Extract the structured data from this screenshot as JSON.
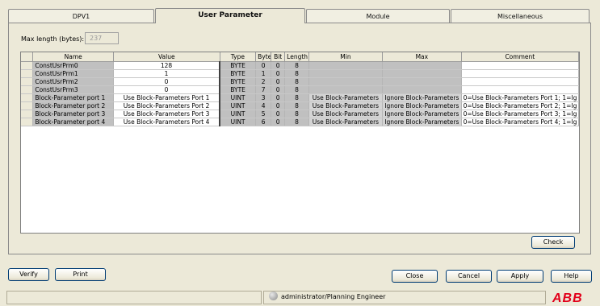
{
  "tabs": [
    "DPV1",
    "User Parameter",
    "Module",
    "Miscellaneous"
  ],
  "max_length": {
    "label": "Max length (bytes):",
    "value": "237"
  },
  "columns": [
    "Name",
    "Value",
    "Type",
    "Byte",
    "Bit",
    "Length",
    "Min",
    "Max",
    "Comment"
  ],
  "rows": [
    {
      "name": "ConstUsrPrm0",
      "value": "128",
      "type": "BYTE",
      "byte": "0",
      "bit": "0",
      "length": "8",
      "min": "",
      "max": "",
      "comment": ""
    },
    {
      "name": "ConstUsrPrm1",
      "value": "1",
      "type": "BYTE",
      "byte": "1",
      "bit": "0",
      "length": "8",
      "min": "",
      "max": "",
      "comment": ""
    },
    {
      "name": "ConstUsrPrm2",
      "value": "0",
      "type": "BYTE",
      "byte": "2",
      "bit": "0",
      "length": "8",
      "min": "",
      "max": "",
      "comment": ""
    },
    {
      "name": "ConstUsrPrm3",
      "value": "0",
      "type": "BYTE",
      "byte": "7",
      "bit": "0",
      "length": "8",
      "min": "",
      "max": "",
      "comment": ""
    },
    {
      "name": "Block-Parameter port 1",
      "value": "Use Block-Parameters Port 1",
      "type": "UINT",
      "byte": "3",
      "bit": "0",
      "length": "8",
      "min": "Use Block-Parameters",
      "max": "Ignore Block-Parameters",
      "comment": "0=Use Block-Parameters Port 1; 1=Ig"
    },
    {
      "name": "Block-Parameter port 2",
      "value": "Use Block-Parameters Port 2",
      "type": "UINT",
      "byte": "4",
      "bit": "0",
      "length": "8",
      "min": "Use Block-Parameters",
      "max": "Ignore Block-Parameters",
      "comment": "0=Use Block-Parameters Port 2; 1=Ig"
    },
    {
      "name": "Block-Parameter port 3",
      "value": "Use Block-Parameters Port 3",
      "type": "UINT",
      "byte": "5",
      "bit": "0",
      "length": "8",
      "min": "Use Block-Parameters",
      "max": "Ignore Block-Parameters",
      "comment": "0=Use Block-Parameters Port 3; 1=Ig"
    },
    {
      "name": "Block-Parameter port 4",
      "value": "Use Block-Parameters Port 4",
      "type": "UINT",
      "byte": "6",
      "bit": "0",
      "length": "8",
      "min": "Use Block-Parameters",
      "max": "Ignore Block-Parameters",
      "comment": "0=Use Block-Parameters Port 4; 1=Ig"
    }
  ],
  "buttons": {
    "check": "Check",
    "verify": "Verify",
    "print": "Print",
    "close": "Close",
    "cancel": "Cancel",
    "apply": "Apply",
    "help": "Help"
  },
  "status": {
    "user": "administrator/Planning Engineer",
    "icon": "globe-icon"
  },
  "logo": "ABB",
  "colors": {
    "logo": "#e2001a",
    "background": "#ece9d8"
  }
}
